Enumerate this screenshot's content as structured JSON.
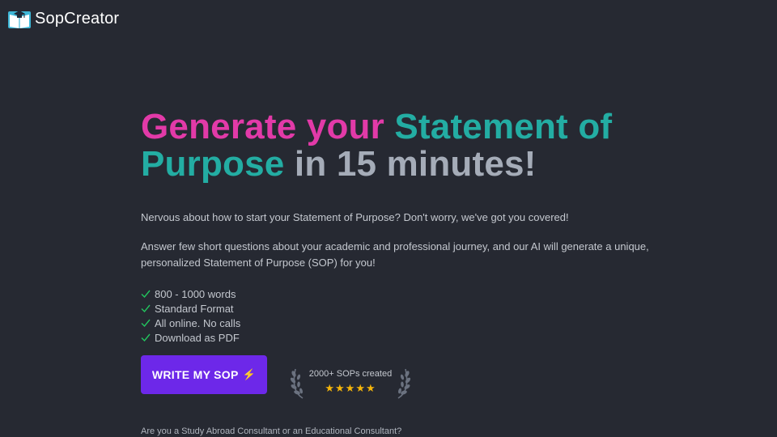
{
  "header": {
    "logo_text": "SopCreator"
  },
  "hero": {
    "headline": {
      "part1": "Generate your",
      "part2": "Statement of",
      "part3": "Purpose",
      "part4": "in 15 minutes!"
    },
    "description_1": "Nervous about how to start your Statement of Purpose? Don't worry, we've got you covered!",
    "description_2": "Answer few short questions about your academic and professional journey, and our AI will generate a unique, personalized Statement of Purpose (SOP) for you!",
    "features": [
      "800 - 1000 words",
      "Standard Format",
      "All online. No calls",
      "Download as PDF"
    ],
    "cta_label": "WRITE MY SOP",
    "cta_icon": "⚡",
    "award_text": "2000+ SOPs created",
    "rating_stars": "★★★★★",
    "consultant_question": "Are you a Study Abroad Consultant or an Educational Consultant?"
  },
  "colors": {
    "background": "#262932",
    "pink": "#e23aa8",
    "teal": "#23ada3",
    "gray": "#a5acb8",
    "cta": "#6d28e9",
    "check": "#22c55e",
    "star": "#f5b50a"
  },
  "icons": {
    "logo": "graduation-cap-book-icon",
    "feature": "check-icon",
    "award": "laurel-wreath-icon"
  }
}
